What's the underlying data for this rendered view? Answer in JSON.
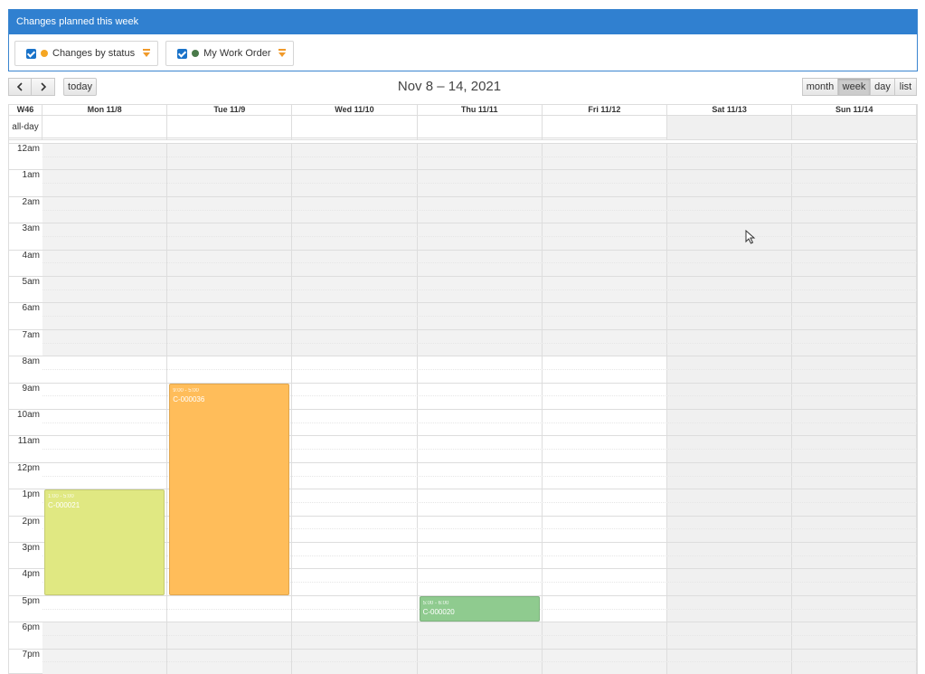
{
  "panel": {
    "title": "Changes planned this week"
  },
  "filters": [
    {
      "label": "Changes by status",
      "dot_color": "#f5a623",
      "checked": true
    },
    {
      "label": "My Work Order",
      "dot_color": "#4a7a4a",
      "checked": true
    }
  ],
  "toolbar": {
    "prev_icon": "chevron-left",
    "next_icon": "chevron-right",
    "today_label": "today",
    "title": "Nov 8 – 14, 2021",
    "views": [
      "month",
      "week",
      "day",
      "list"
    ],
    "active_view": "week"
  },
  "calendar": {
    "week_label": "W46",
    "allday_label": "all-day",
    "days": [
      "Mon 11/8",
      "Tue 11/9",
      "Wed 11/10",
      "Thu 11/11",
      "Fri 11/12",
      "Sat 11/13",
      "Sun 11/14"
    ],
    "hours": [
      "12am",
      "1am",
      "2am",
      "3am",
      "4am",
      "5am",
      "6am",
      "7am",
      "8am",
      "9am",
      "10am",
      "11am",
      "12pm",
      "1pm",
      "2pm",
      "3pm",
      "4pm",
      "5pm",
      "6pm",
      "7pm"
    ],
    "events": [
      {
        "day": 0,
        "time": "1:00 - 5:00",
        "title": "C-000021",
        "color": "#e0e882",
        "start": 13,
        "end": 17
      },
      {
        "day": 1,
        "time": "9:00 - 5:00",
        "title": "C-000036",
        "color": "#ffbd5a",
        "start": 9,
        "end": 17
      },
      {
        "day": 3,
        "time": "5:00 - 6:00",
        "title": "C-000020",
        "color": "#8fcb8f",
        "start": 17,
        "end": 18
      }
    ]
  }
}
